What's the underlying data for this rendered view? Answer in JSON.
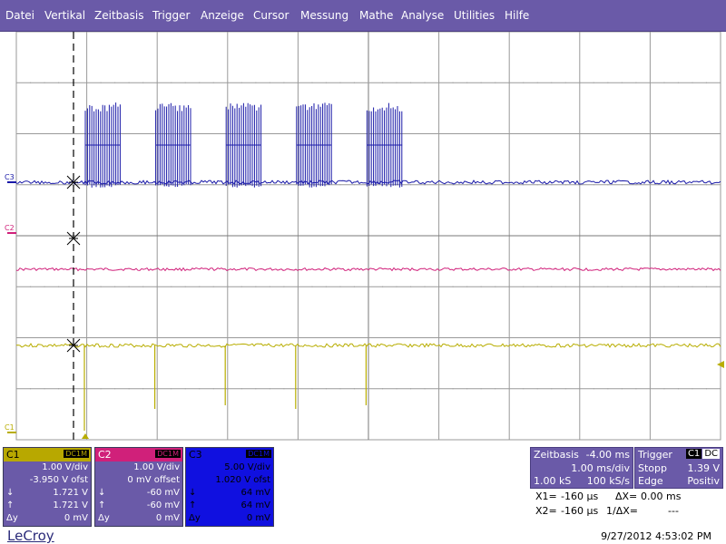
{
  "menu": {
    "items": [
      "Datei",
      "Vertikal",
      "Zeitbasis",
      "Trigger",
      "Anzeige",
      "Cursor",
      "Messung",
      "Mathe",
      "Analyse",
      "Utilities",
      "Hilfe"
    ]
  },
  "scope": {
    "grid": {
      "h_divs": 10,
      "v_divs": 8
    },
    "trace_labels": {
      "c3": "C3",
      "c2": "C2",
      "c1": "C1"
    },
    "colors": {
      "c1": "#b8ad00",
      "c2": "#d0207a",
      "c3": "#1a1aa8",
      "grid": "#9a9a9a",
      "cursor": "#000000"
    },
    "c3_bursts": {
      "count": 5,
      "period_ms": 1.0,
      "burst_width_ms": 0.5
    },
    "c1_spikes": {
      "count": 5,
      "period_ms": 1.0
    }
  },
  "channels": [
    {
      "name": "C1",
      "coupling": "DC1M",
      "volts_per_div": "1.00 V/div",
      "offset": "-3.950 V ofst",
      "down_label": "↓",
      "down_value": "1.721 V",
      "up_label": "↑",
      "up_value": "1.721 V",
      "delta_label": "Δy",
      "delta_value": "0 mV",
      "head_color": "#b8a800",
      "body_color": "#6a5aa8",
      "text_color": "#ffffff",
      "title_color": "#000000"
    },
    {
      "name": "C2",
      "coupling": "DC1M",
      "volts_per_div": "1.00 V/div",
      "offset": "0 mV offset",
      "down_label": "↓",
      "down_value": "-60 mV",
      "up_label": "↑",
      "up_value": "-60 mV",
      "delta_label": "Δy",
      "delta_value": "0 mV",
      "head_color": "#d0207a",
      "body_color": "#6a5aa8",
      "text_color": "#ffffff",
      "title_color": "#ffffff"
    },
    {
      "name": "C3",
      "coupling": "DC1M",
      "volts_per_div": "5.00 V/div",
      "offset": "1.020 V ofst",
      "down_label": "↓",
      "down_value": "64 mV",
      "up_label": "↑",
      "up_value": "64 mV",
      "delta_label": "Δy",
      "delta_value": "0 mV",
      "head_color": "#1010e0",
      "body_color": "#1010e0",
      "text_color": "#000000",
      "title_color": "#000000"
    }
  ],
  "timebase": {
    "title": "Zeitbasis",
    "delay": "-4.00 ms",
    "time_per_div": "1.00 ms/div",
    "samples": "1.00 kS",
    "sample_rate": "100 kS/s"
  },
  "trigger": {
    "title": "Trigger",
    "channel": "C1",
    "coupling": "DC",
    "mode": "Stopp",
    "level": "1.39 V",
    "type": "Edge",
    "slope": "Positiv"
  },
  "cursors": {
    "x1_label": "X1=",
    "x1_value": "-160 µs",
    "dx_label": "ΔX=",
    "dx_value": "0.00 ms",
    "x2_label": "X2=",
    "x2_value": "-160 µs",
    "inv_dx_label": "1/ΔX=",
    "inv_dx_value": "---"
  },
  "footer": {
    "logo": "LeCroy",
    "timestamp": "9/27/2012 4:53:02 PM"
  }
}
